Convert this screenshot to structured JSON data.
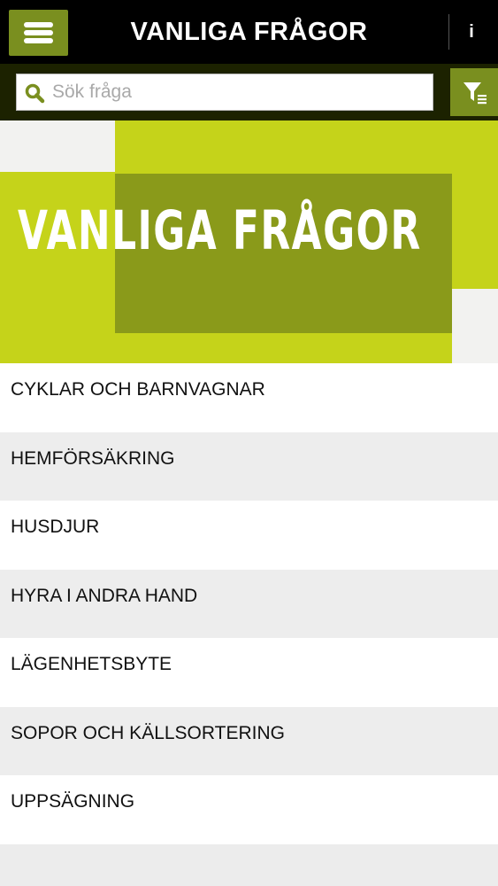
{
  "header": {
    "title": "VANLIGA FRÅGOR",
    "info_label": "i"
  },
  "search": {
    "placeholder": "Sök fråga",
    "value": ""
  },
  "banner": {
    "text": "VANLIGA FRÅGOR"
  },
  "faq": {
    "categories": [
      {
        "label": "CYKLAR OCH BARNVAGNAR"
      },
      {
        "label": "HEMFÖRSÄKRING"
      },
      {
        "label": "HUSDJUR"
      },
      {
        "label": "HYRA I ANDRA HAND"
      },
      {
        "label": "LÄGENHETSBYTE"
      },
      {
        "label": "SOPOR OCH KÄLLSORTERING"
      },
      {
        "label": "UPPSÄGNING"
      }
    ]
  },
  "colors": {
    "accent": "#7a8f1f",
    "banner_green": "#c5d31a",
    "banner_olive": "#8a9a1a",
    "topbar": "#000000"
  },
  "icons": {
    "menu": "hamburger-icon",
    "search": "magnifier-icon",
    "filter": "filter-list-icon",
    "info": "info-icon"
  }
}
